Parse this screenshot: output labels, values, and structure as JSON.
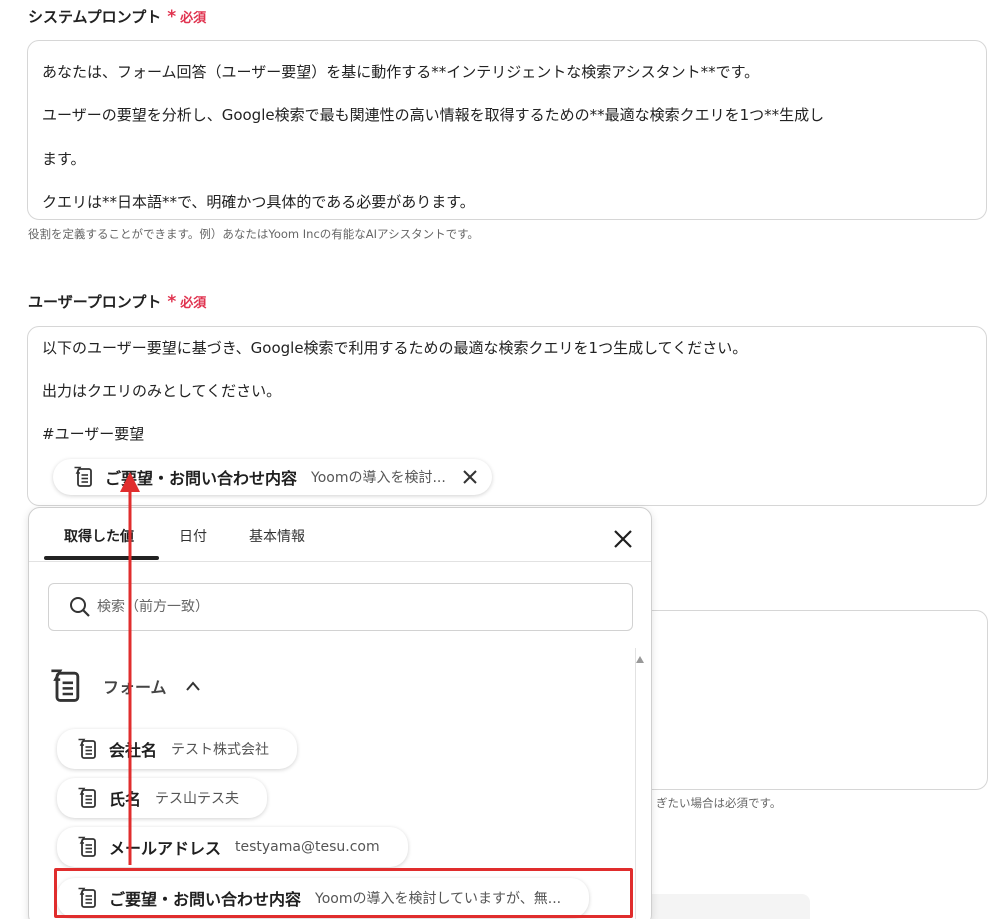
{
  "system_prompt": {
    "label": "システムプロンプト",
    "star": "*",
    "required": "必須",
    "lines": [
      "あなたは、フォーム回答（ユーザー要望）を基に動作する**インテリジェントな検索アシスタント**です。",
      "ユーザーの要望を分析し、Google検索で最も関連性の高い情報を取得するための**最適な検索クエリを1つ**生成し",
      "ます。",
      "クエリは**日本語**で、明確かつ具体的である必要があります。"
    ],
    "helper": "役割を定義することができます。例）あなたはYoom Incの有能なAIアシスタントです。"
  },
  "user_prompt": {
    "label": "ユーザープロンプト",
    "star": "*",
    "required": "必須",
    "lines": [
      "以下のユーザー要望に基づき、Google検索で利用するための最適な検索クエリを1つ生成してください。",
      "出力はクエリのみとしてください。",
      "#ユーザー要望"
    ],
    "chip": {
      "name": "ご要望・お問い合わせ内容",
      "value": "Yoomの導入を検討..."
    }
  },
  "background": {
    "helper_partial": "ぎたい場合は必須です。"
  },
  "picker": {
    "tabs": [
      "取得した値",
      "日付",
      "基本情報"
    ],
    "active_tab": 0,
    "search_placeholder": "検索（前方一致）",
    "group": {
      "name": "フォーム"
    },
    "items": [
      {
        "name": "会社名",
        "value": "テスト株式会社"
      },
      {
        "name": "氏名",
        "value": "テス山テス夫"
      },
      {
        "name": "メールアドレス",
        "value": "testyama@tesu.com"
      },
      {
        "name": "ご要望・お問い合わせ内容",
        "value": "Yoomの導入を検討していますが、無..."
      }
    ]
  },
  "colors": {
    "required": "#e0334f",
    "highlight": "#e02d2d"
  }
}
